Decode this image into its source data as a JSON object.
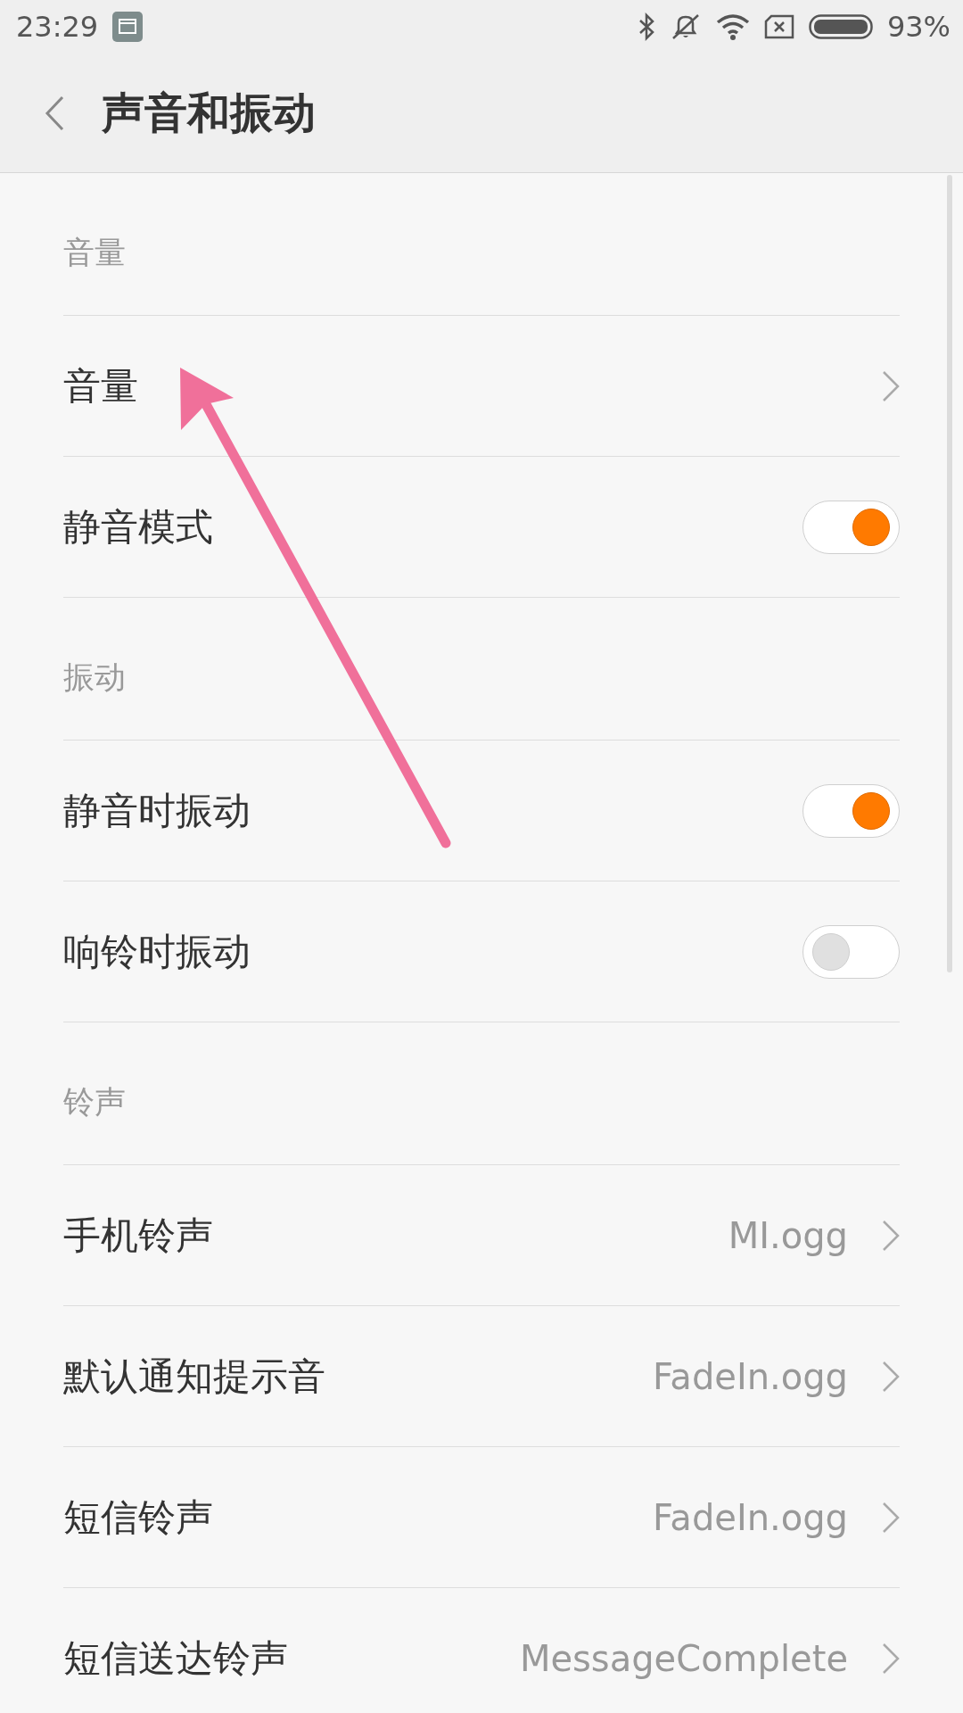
{
  "status_bar": {
    "time": "23:29",
    "battery": "93%"
  },
  "toolbar": {
    "title": "声音和振动"
  },
  "sections": [
    {
      "header": "音量",
      "items": [
        {
          "kind": "link",
          "label": "音量"
        },
        {
          "kind": "switch",
          "label": "静音模式",
          "on": true
        }
      ]
    },
    {
      "header": "振动",
      "items": [
        {
          "kind": "switch",
          "label": "静音时振动",
          "on": true
        },
        {
          "kind": "switch",
          "label": "响铃时振动",
          "on": false
        }
      ]
    },
    {
      "header": "铃声",
      "items": [
        {
          "kind": "link",
          "label": "手机铃声",
          "value": "MI.ogg"
        },
        {
          "kind": "link",
          "label": "默认通知提示音",
          "value": "FadeIn.ogg"
        },
        {
          "kind": "link",
          "label": "短信铃声",
          "value": "FadeIn.ogg"
        },
        {
          "kind": "link",
          "label": "短信送达铃声",
          "value": "MessageComplete"
        }
      ]
    }
  ]
}
